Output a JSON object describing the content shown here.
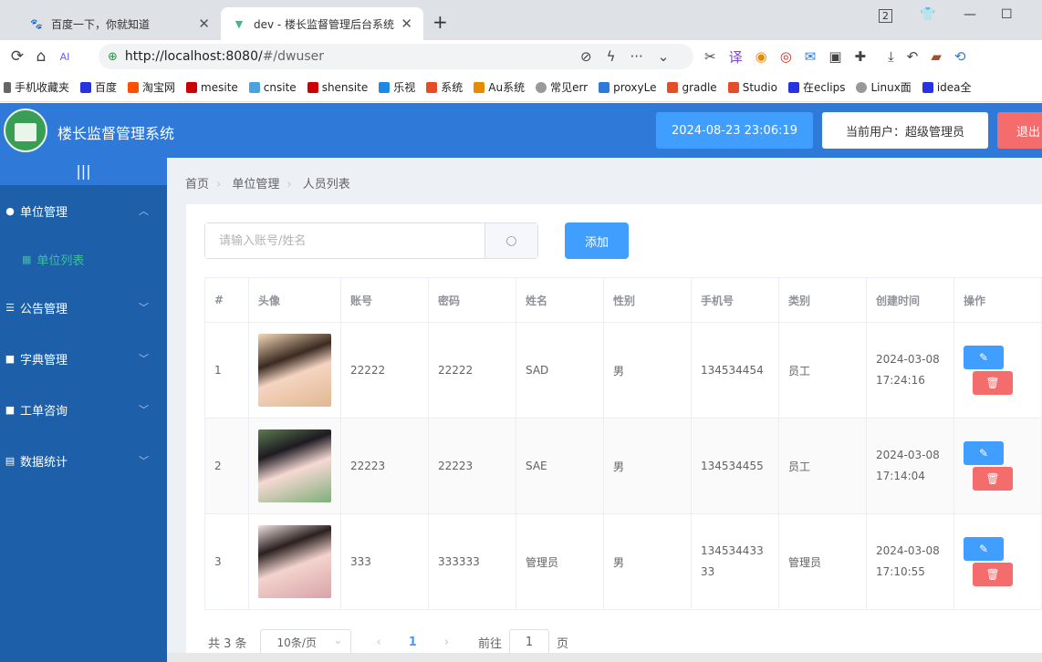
{
  "browser": {
    "tabs": [
      {
        "title": "百度一下，你就知道",
        "favicon": "baidu-icon"
      },
      {
        "title": "dev - 楼长监督管理后台系统",
        "favicon": "vue-icon"
      }
    ],
    "tab_count_badge": "2",
    "url_host": "http://localhost:8080/",
    "url_path": "#/dwuser",
    "bookmarks": [
      "手机收藏夹",
      "百度",
      "淘宝网",
      "mesite",
      "cnsite",
      "shensite",
      "乐视",
      "系统",
      "Au系统",
      "常见err",
      "proxyLe",
      "gradle",
      "Studio",
      "在eclips",
      "Linux面",
      "idea全"
    ]
  },
  "header": {
    "title": "楼长监督管理系统",
    "datetime": "2024-08-23 23:06:19",
    "current_user": "当前用户：超级管理员",
    "logout_label": "退出"
  },
  "sidebar": {
    "collapse_label": "|||",
    "menus": [
      {
        "label": "单位管理",
        "icon": "user-icon",
        "expanded": true,
        "children": [
          {
            "label": "单位列表"
          }
        ]
      },
      {
        "label": "公告管理",
        "icon": "settings-icon",
        "expanded": false
      },
      {
        "label": "字典管理",
        "icon": "lock-icon",
        "expanded": false
      },
      {
        "label": "工单咨询",
        "icon": "lock-icon",
        "expanded": false
      },
      {
        "label": "数据统计",
        "icon": "document-icon",
        "expanded": false
      }
    ]
  },
  "breadcrumb": [
    "首页",
    "单位管理",
    "人员列表"
  ],
  "search": {
    "placeholder": "请输入账号/姓名"
  },
  "add_label": "添加",
  "table": {
    "columns": [
      "#",
      "头像",
      "账号",
      "密码",
      "姓名",
      "性别",
      "手机号",
      "类别",
      "创建时间",
      "操作"
    ],
    "rows": [
      {
        "idx": "1",
        "account": "22222",
        "password": "22222",
        "name": "SAD",
        "gender": "男",
        "phone": "134534454",
        "type": "员工",
        "created": "2024-03-08 17:24:16",
        "avatar_color": "#e0b890"
      },
      {
        "idx": "2",
        "account": "22223",
        "password": "22223",
        "name": "SAE",
        "gender": "男",
        "phone": "134534455",
        "type": "员工",
        "created": "2024-03-08 17:14:04",
        "avatar_color": "#7fae7a"
      },
      {
        "idx": "3",
        "account": "333",
        "password": "333333",
        "name": "管理员",
        "gender": "男",
        "phone": "13453443333",
        "type": "管理员",
        "created": "2024-03-08 17:10:55",
        "avatar_color": "#d9a3a8"
      }
    ]
  },
  "pagination": {
    "total": "共 3 条",
    "page_size": "10条/页",
    "current": "1",
    "goto_prefix": "前往",
    "goto_value": "1",
    "goto_suffix": "页"
  },
  "colors": {
    "primary": "#409eff",
    "danger": "#f56c6c",
    "header": "#2f7ad8",
    "sidebar": "#1d5fa8"
  }
}
